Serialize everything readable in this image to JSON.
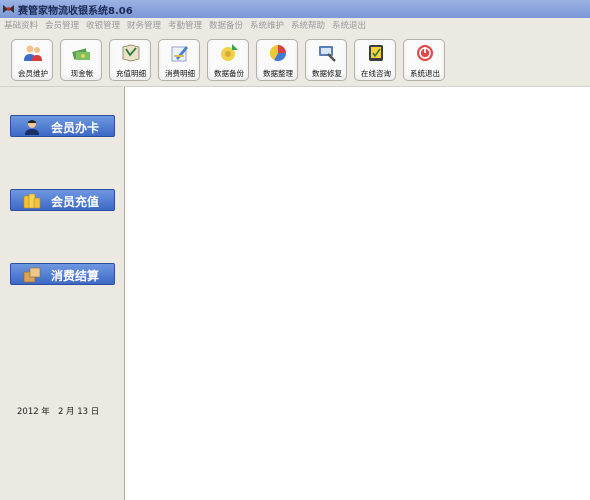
{
  "window": {
    "title": "赛管家物流收银系统8.06"
  },
  "menu": {
    "items": [
      "基础资料",
      "会员管理",
      "收银管理",
      "财务管理",
      "考勤管理",
      "数据备份",
      "系统维护",
      "系统帮助",
      "系统退出"
    ]
  },
  "toolbar": {
    "buttons": [
      {
        "label": "会员维护",
        "icon": "members-icon"
      },
      {
        "label": "现金帐",
        "icon": "cash-icon"
      },
      {
        "label": "充值明细",
        "icon": "recharge-detail-icon"
      },
      {
        "label": "消费明细",
        "icon": "consumption-detail-icon"
      },
      {
        "label": "数据备份",
        "icon": "backup-icon"
      },
      {
        "label": "数据整理",
        "icon": "organize-data-icon"
      },
      {
        "label": "数据修复",
        "icon": "repair-data-icon"
      },
      {
        "label": "在线咨询",
        "icon": "online-help-icon"
      },
      {
        "label": "系统退出",
        "icon": "exit-icon"
      }
    ]
  },
  "sidebar": {
    "buttons": [
      {
        "label": "会员办卡",
        "icon": "member-card-icon"
      },
      {
        "label": "会员充值",
        "icon": "coins-icon"
      },
      {
        "label": "消费结算",
        "icon": "checkout-icon"
      }
    ],
    "date": "2012 年   2 月 13 日"
  },
  "colors": {
    "titlebar": "#7b97d6",
    "sidebar_button": "#4a75cf",
    "menu_text": "#9a9a9a"
  }
}
